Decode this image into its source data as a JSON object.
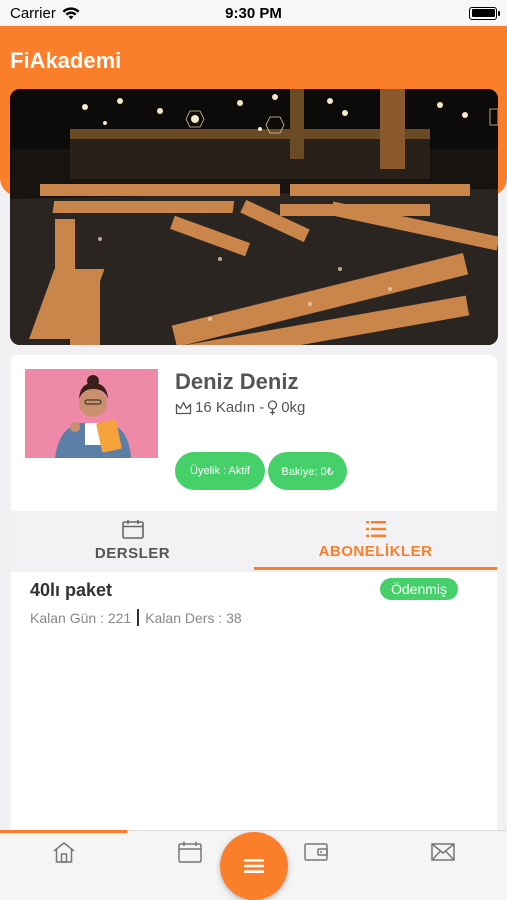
{
  "status_bar": {
    "carrier": "Carrier",
    "time": "9:30 PM"
  },
  "header": {
    "title": "FiAkademi"
  },
  "profile": {
    "name": "Deniz Deniz",
    "meta": "16 Kadın - ",
    "weight": "0kg",
    "membership_badge": "Üyelik : Aktif",
    "balance_badge": "Bakiye: 0₺"
  },
  "tabs": [
    {
      "label": "DERSLER",
      "icon": "calendar-icon"
    },
    {
      "label": "ABONELİKLER",
      "icon": "list-icon"
    }
  ],
  "subscription": {
    "title": "40lı paket",
    "status": "Ödenmiş",
    "remaining_days": "Kalan Gün : 221",
    "remaining_lessons": "Kalan Ders : 38"
  },
  "bottom_nav": {
    "items": [
      "home-icon",
      "calendar-icon",
      "menu-icon",
      "wallet-icon",
      "mail-icon"
    ]
  },
  "colors": {
    "accent": "#fb7f2a",
    "success": "#45d06a"
  }
}
